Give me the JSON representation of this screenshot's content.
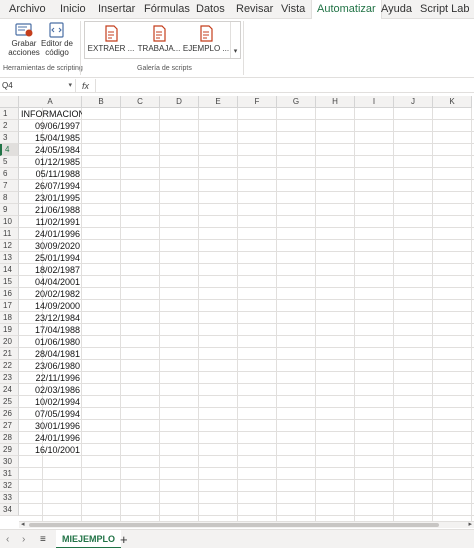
{
  "menu": {
    "tabs": [
      "Archivo",
      "Inicio",
      "Insertar",
      "Fórmulas",
      "Datos",
      "Revisar",
      "Vista",
      "Automatizar",
      "Ayuda",
      "Script Lab"
    ],
    "active": "Automatizar"
  },
  "ribbon": {
    "record_label_1": "Grabar",
    "record_label_2": "acciones",
    "editor_label_1": "Editor de",
    "editor_label_2": "código",
    "group1_label": "Herramientas de scripting",
    "group2_label": "Galería de scripts",
    "scripts": [
      "EXTRAER ...",
      "TRABAJA...",
      "EJEMPLO ..."
    ]
  },
  "formula_bar": {
    "name_box": "Q4",
    "fx": "fx",
    "value": ""
  },
  "grid": {
    "columns": [
      "A",
      "B",
      "C",
      "D",
      "E",
      "F",
      "G",
      "H",
      "I",
      "J",
      "K"
    ],
    "rows": [
      "1",
      "2",
      "3",
      "4",
      "5",
      "6",
      "7",
      "8",
      "9",
      "10",
      "11",
      "12",
      "13",
      "14",
      "15",
      "16",
      "17",
      "18",
      "19",
      "20",
      "21",
      "22",
      "23",
      "24",
      "25",
      "26",
      "27",
      "28",
      "29",
      "30",
      "31",
      "32",
      "33",
      "34"
    ],
    "selected_row": "4",
    "column_a": [
      "INFORMACION",
      "09/06/1997",
      "15/04/1985",
      "24/05/1984",
      "01/12/1985",
      "05/11/1988",
      "26/07/1994",
      "23/01/1995",
      "21/06/1988",
      "11/02/1991",
      "24/01/1996",
      "30/09/2020",
      "25/01/1994",
      "18/02/1987",
      "04/04/2001",
      "20/02/1982",
      "14/09/2000",
      "23/12/1984",
      "17/04/1988",
      "01/06/1980",
      "28/04/1981",
      "23/06/1980",
      "22/11/1996",
      "02/03/1986",
      "10/02/1994",
      "07/05/1994",
      "30/01/1996",
      "24/01/1996",
      "16/10/2001"
    ]
  },
  "sheets": {
    "active": "MIEJEMPLO",
    "add": "+",
    "menu": "≡",
    "prev": "‹",
    "next": "›"
  },
  "colors": {
    "accent": "#217346",
    "script_icon": "#c43e1c"
  }
}
